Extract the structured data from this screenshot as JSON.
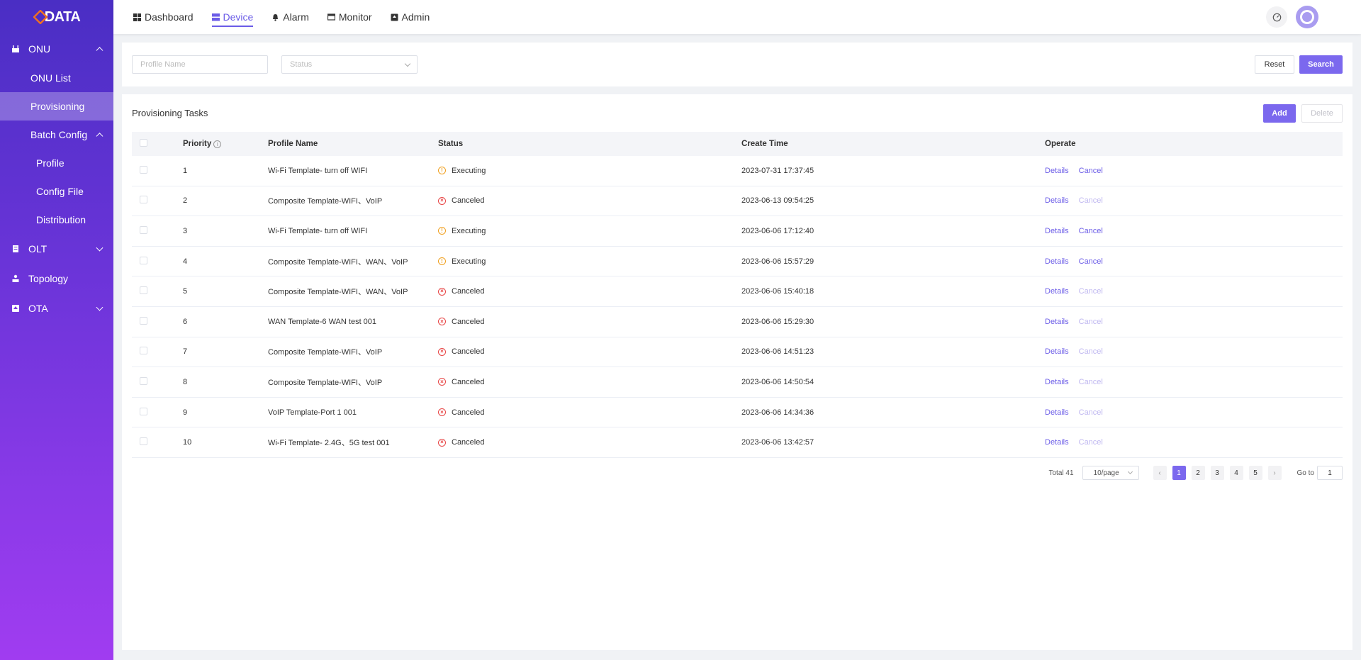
{
  "brand": {
    "logo_text": "DATA"
  },
  "sidebar": {
    "onu": {
      "label": "ONU",
      "icon": "onu-icon"
    },
    "onu_list": "ONU List",
    "provisioning": "Provisioning",
    "batch_config": "Batch Config",
    "profile": "Profile",
    "config_file": "Config File",
    "distribution": "Distribution",
    "olt": {
      "label": "OLT",
      "icon": "olt-icon"
    },
    "topology": {
      "label": "Topology",
      "icon": "topology-icon"
    },
    "ota": {
      "label": "OTA",
      "icon": "ota-icon"
    }
  },
  "nav": {
    "tabs": [
      {
        "label": "Dashboard",
        "icon": "dashboard-icon"
      },
      {
        "label": "Device",
        "icon": "device-icon"
      },
      {
        "label": "Alarm",
        "icon": "bell-icon"
      },
      {
        "label": "Monitor",
        "icon": "monitor-icon"
      },
      {
        "label": "Admin",
        "icon": "admin-icon"
      }
    ],
    "active_tab": "Device"
  },
  "filters": {
    "profile_name_placeholder": "Profile Name",
    "status_placeholder": "Status",
    "reset_label": "Reset",
    "search_label": "Search"
  },
  "card": {
    "title": "Provisioning Tasks",
    "add_label": "Add",
    "delete_label": "Delete"
  },
  "table": {
    "headers": {
      "priority": "Priority",
      "profile_name": "Profile Name",
      "status": "Status",
      "create_time": "Create Time",
      "operate": "Operate"
    },
    "rows": [
      {
        "priority": "1",
        "profile": "Wi-Fi Template- turn off WIFI",
        "status": "Executing",
        "time": "2023-07-31 17:37:45",
        "details": "Details",
        "cancel": "Cancel"
      },
      {
        "priority": "2",
        "profile": "Composite Template-WIFI、VoIP",
        "status": "Canceled",
        "time": "2023-06-13 09:54:25",
        "details": "Details",
        "cancel": "Cancel"
      },
      {
        "priority": "3",
        "profile": "Wi-Fi Template- turn off WIFI",
        "status": "Executing",
        "time": "2023-06-06 17:12:40",
        "details": "Details",
        "cancel": "Cancel"
      },
      {
        "priority": "4",
        "profile": "Composite Template-WIFI、WAN、VoIP",
        "status": "Executing",
        "time": "2023-06-06 15:57:29",
        "details": "Details",
        "cancel": "Cancel"
      },
      {
        "priority": "5",
        "profile": "Composite Template-WIFI、WAN、VoIP",
        "status": "Canceled",
        "time": "2023-06-06 15:40:18",
        "details": "Details",
        "cancel": "Cancel"
      },
      {
        "priority": "6",
        "profile": "WAN Template-6 WAN test 001",
        "status": "Canceled",
        "time": "2023-06-06 15:29:30",
        "details": "Details",
        "cancel": "Cancel"
      },
      {
        "priority": "7",
        "profile": "Composite Template-WIFI、VoIP",
        "status": "Canceled",
        "time": "2023-06-06 14:51:23",
        "details": "Details",
        "cancel": "Cancel"
      },
      {
        "priority": "8",
        "profile": "Composite Template-WIFI、VoIP",
        "status": "Canceled",
        "time": "2023-06-06 14:50:54",
        "details": "Details",
        "cancel": "Cancel"
      },
      {
        "priority": "9",
        "profile": "VoIP Template-Port 1 001",
        "status": "Canceled",
        "time": "2023-06-06 14:34:36",
        "details": "Details",
        "cancel": "Cancel"
      },
      {
        "priority": "10",
        "profile": "Wi-Fi Template- 2.4G、5G test 001",
        "status": "Canceled",
        "time": "2023-06-06 13:42:57",
        "details": "Details",
        "cancel": "Cancel"
      }
    ]
  },
  "pagination": {
    "total": "Total 41",
    "page_size": "10/page",
    "pages": [
      "1",
      "2",
      "3",
      "4",
      "5"
    ],
    "current": "1",
    "goto_label": "Go to",
    "goto_value": "1"
  },
  "colors": {
    "accent": "#7b68ee",
    "executing": "#f0a020",
    "canceled": "#e84545"
  }
}
